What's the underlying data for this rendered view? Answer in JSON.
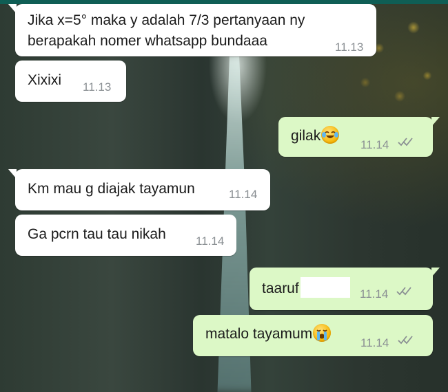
{
  "chat": {
    "messages": [
      {
        "direction": "incoming",
        "lines": [
          "Jika x=5° maka y adalah 7/3 pertanyaan ny",
          "berapakah nomer whatsapp bundaaa"
        ],
        "time": "11.13"
      },
      {
        "direction": "incoming",
        "text": "Xixixi",
        "time": "11.13"
      },
      {
        "direction": "outgoing",
        "text": "gilak",
        "emoji": "crying-laughing-emoji",
        "time": "11.14",
        "status": "delivered"
      },
      {
        "direction": "incoming",
        "text": "Km mau g diajak tayamun",
        "time": "11.14"
      },
      {
        "direction": "incoming",
        "text": "Ga pcrn tau tau nikah",
        "time": "11.14"
      },
      {
        "direction": "outgoing",
        "text": "taaruf",
        "redacted": true,
        "time": "11.14",
        "status": "delivered"
      },
      {
        "direction": "outgoing",
        "text": "matalo tayamum",
        "emoji": "loudly-crying-emoji",
        "time": "11.14",
        "status": "delivered"
      }
    ]
  },
  "colors": {
    "incoming_bubble": "#ffffff",
    "outgoing_bubble": "#dcf8c6",
    "timestamp": "#8a8f93",
    "ticks": "#8a8f93"
  }
}
